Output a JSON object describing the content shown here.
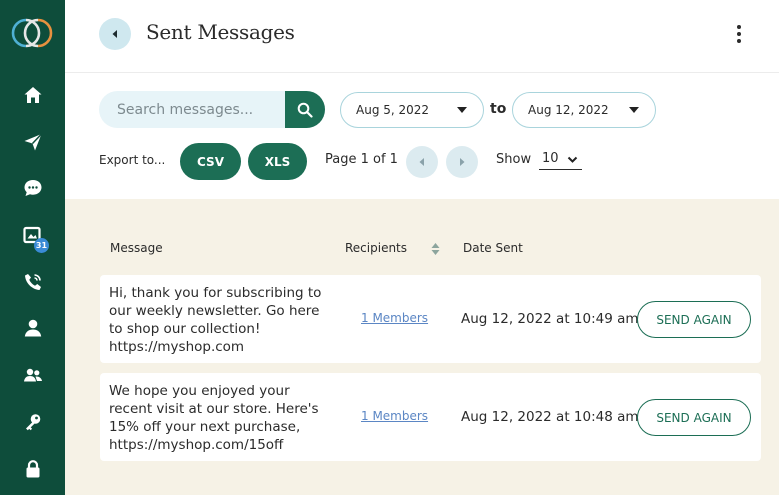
{
  "app": {
    "brand_colors": {
      "sidebar": "#0e4d3b",
      "accent": "#1c6e55",
      "light_blue": "#cfe8ef",
      "background": "#f6f2e6"
    }
  },
  "sidebar": {
    "items": [
      {
        "name": "home",
        "icon": "home-icon"
      },
      {
        "name": "send",
        "icon": "send-icon"
      },
      {
        "name": "chat",
        "icon": "chat-icon"
      },
      {
        "name": "scheduled",
        "icon": "calendar-icon",
        "badge": "31"
      },
      {
        "name": "calls",
        "icon": "phone-icon"
      },
      {
        "name": "contact",
        "icon": "user-icon"
      },
      {
        "name": "groups",
        "icon": "users-icon"
      },
      {
        "name": "keys",
        "icon": "key-icon"
      },
      {
        "name": "security",
        "icon": "lock-icon"
      }
    ]
  },
  "header": {
    "title": "Sent Messages"
  },
  "toolbar": {
    "search_placeholder": "Search messages...",
    "date_from": "Aug 5, 2022",
    "to_label": "to",
    "date_to": "Aug 12, 2022",
    "export_label": "Export to...",
    "export_csv": "CSV",
    "export_xls": "XLS",
    "page_info": "Page 1 of 1",
    "show_label": "Show",
    "show_value": "10"
  },
  "table": {
    "columns": {
      "message": "Message",
      "recipients": "Recipients",
      "date_sent": "Date Sent"
    },
    "rows": [
      {
        "message": "Hi, thank you for subscribing to our weekly newsletter. Go here to shop our collection! https://myshop.com",
        "recipients": "1 Members",
        "date_sent": "Aug 12, 2022 at 10:49 am",
        "action": "SEND AGAIN"
      },
      {
        "message": "We hope you enjoyed your recent visit at our store. Here's 15% off your next purchase, https://myshop.com/15off",
        "recipients": "1 Members",
        "date_sent": "Aug 12, 2022 at 10:48 am",
        "action": "SEND AGAIN"
      }
    ]
  }
}
